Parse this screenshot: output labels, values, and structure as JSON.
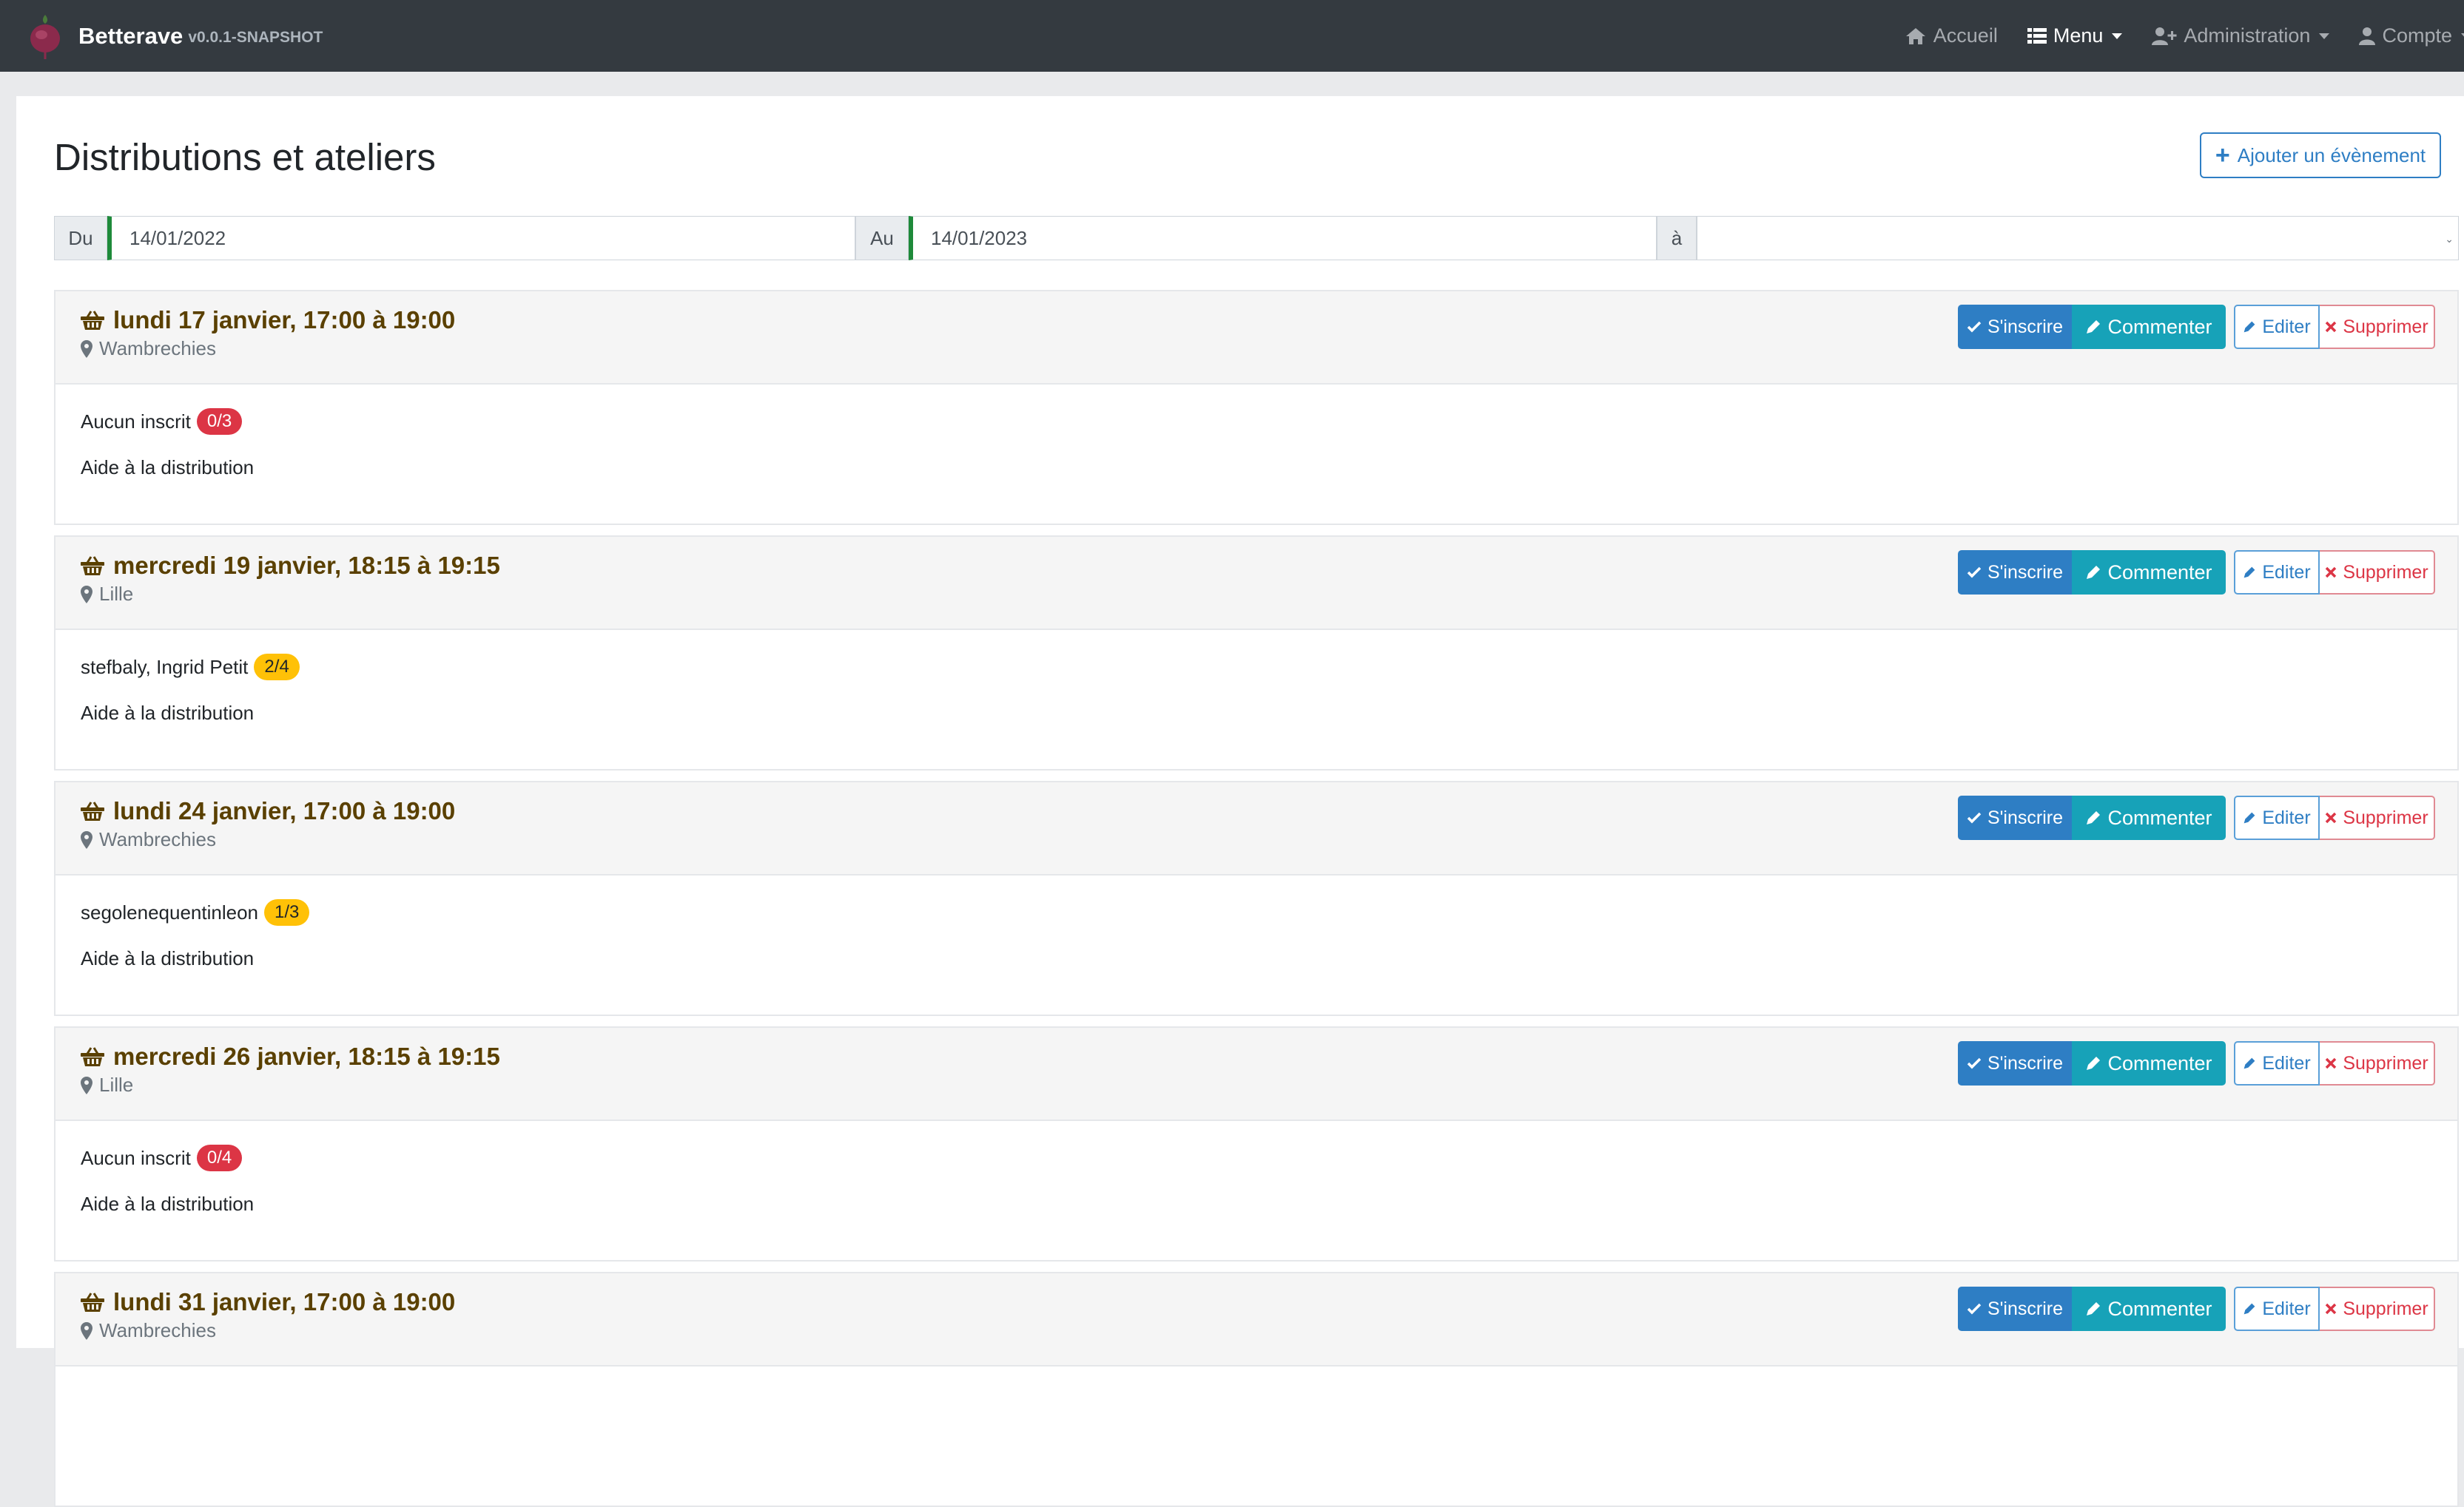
{
  "app": {
    "name": "Betterave",
    "version": "v0.0.1-SNAPSHOT"
  },
  "nav": {
    "home": "Accueil",
    "menu": "Menu",
    "admin": "Administration",
    "account": "Compte"
  },
  "page": {
    "title": "Distributions et ateliers",
    "add_button": "Ajouter un évènement"
  },
  "filter": {
    "from_label": "Du",
    "from_value": "14/01/2022",
    "to_label": "Au",
    "to_value": "14/01/2023",
    "at_label": "à",
    "at_value": ""
  },
  "actions": {
    "subscribe": "S'inscrire",
    "comment": "Commenter",
    "edit": "Editer",
    "delete": "Supprimer"
  },
  "colors": {
    "navbar": "#343a40",
    "primary": "#2e7ec4",
    "info": "#17a2b8",
    "danger": "#dc3545",
    "warning": "#ffc107",
    "title_brown": "#5a4000",
    "date_accent": "#1e8a3a"
  },
  "icons": {
    "home": "home-icon",
    "menu": "list-icon",
    "admin": "user-plus-icon",
    "account": "user-icon",
    "event": "basket-icon",
    "location": "map-pin-icon",
    "subscribe": "check-icon",
    "comment": "pencil-icon",
    "edit": "pencil-icon",
    "delete": "times-icon",
    "add": "plus-icon"
  },
  "events": [
    {
      "title": "lundi 17 janvier, 17:00 à 19:00",
      "location": "Wambrechies",
      "participants": "Aucun inscrit",
      "count": "0/3",
      "badge": "red",
      "role": "Aide à la distribution"
    },
    {
      "title": "mercredi 19 janvier, 18:15 à 19:15",
      "location": "Lille",
      "participants": "stefbaly, Ingrid Petit",
      "count": "2/4",
      "badge": "yellow",
      "role": "Aide à la distribution"
    },
    {
      "title": "lundi 24 janvier, 17:00 à 19:00",
      "location": "Wambrechies",
      "participants": "segolenequentinleon",
      "count": "1/3",
      "badge": "yellow",
      "role": "Aide à la distribution"
    },
    {
      "title": "mercredi 26 janvier, 18:15 à 19:15",
      "location": "Lille",
      "participants": "Aucun inscrit",
      "count": "0/4",
      "badge": "red",
      "role": "Aide à la distribution"
    },
    {
      "title": "lundi 31 janvier, 17:00 à 19:00",
      "location": "Wambrechies",
      "participants": "",
      "count": "",
      "badge": "",
      "role": ""
    }
  ]
}
